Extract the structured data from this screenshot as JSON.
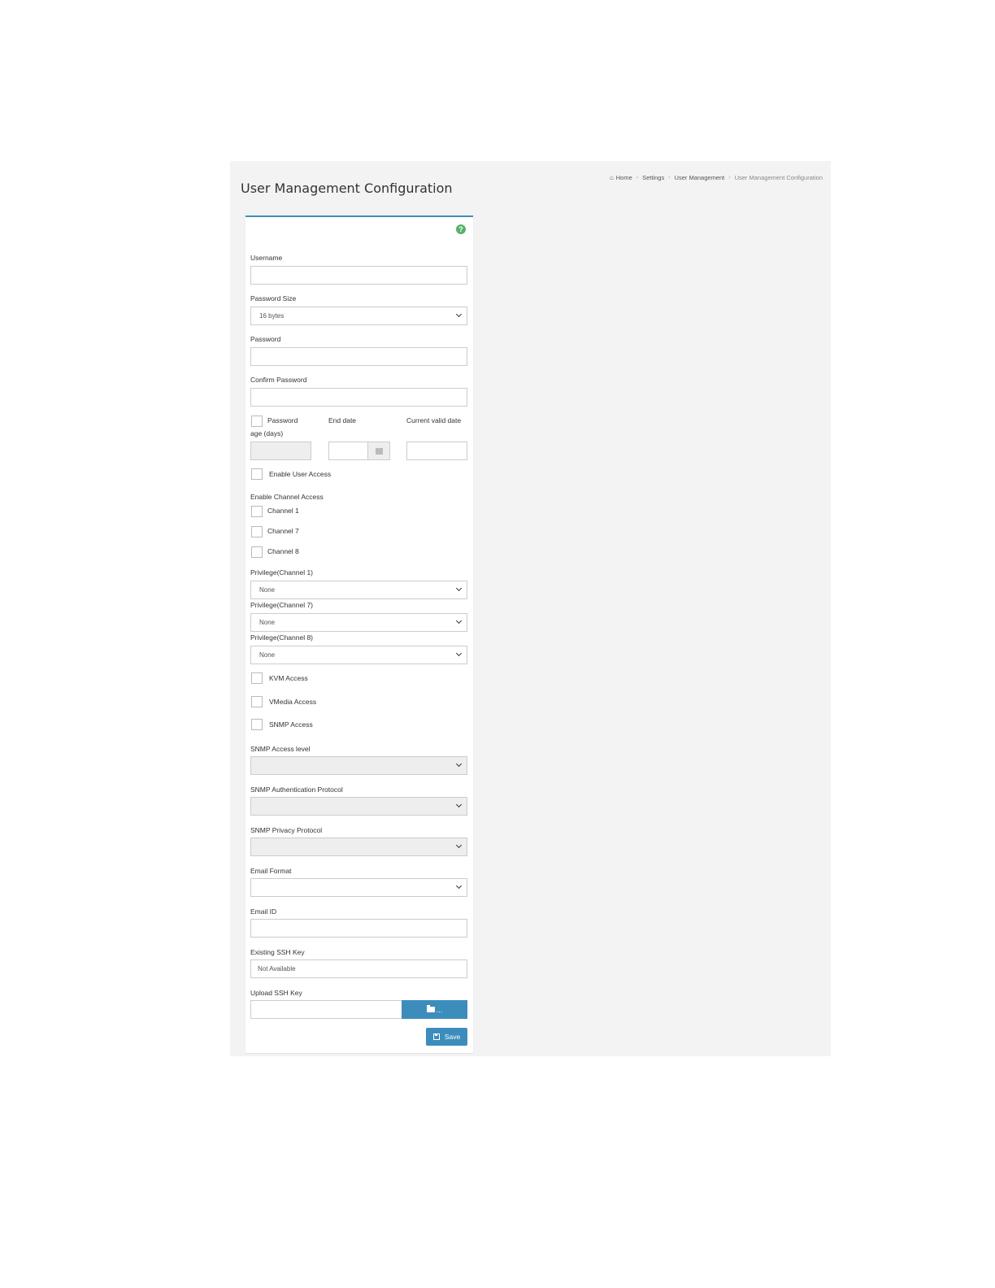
{
  "page": {
    "title": "User Management Configuration"
  },
  "breadcrumb": {
    "home": "Home",
    "settings": "Settings",
    "user_management": "User Management",
    "current": "User Management Configuration"
  },
  "form": {
    "username": {
      "label": "Username",
      "value": ""
    },
    "password_size": {
      "label": "Password Size",
      "value": "16 bytes"
    },
    "password": {
      "label": "Password",
      "value": ""
    },
    "confirm_password": {
      "label": "Confirm Password",
      "value": ""
    },
    "password_age": {
      "label_line1": "Password",
      "label_line2": "age (days)",
      "value": ""
    },
    "end_date": {
      "label": "End date",
      "value": ""
    },
    "current_valid_date": {
      "label": "Current valid date",
      "value": ""
    },
    "enable_user_access": {
      "label": "Enable User Access",
      "checked": false
    },
    "channel_access": {
      "label": "Enable Channel Access",
      "channels": [
        {
          "label": "Channel 1",
          "checked": false
        },
        {
          "label": "Channel 7",
          "checked": false
        },
        {
          "label": "Channel 8",
          "checked": false
        }
      ]
    },
    "privileges": [
      {
        "label": "Privilege(Channel 1)",
        "value": "None"
      },
      {
        "label": "Privilege(Channel 7)",
        "value": "None"
      },
      {
        "label": "Privilege(Channel 8)",
        "value": "None"
      }
    ],
    "kvm_access": {
      "label": "KVM Access",
      "checked": false
    },
    "vmedia_access": {
      "label": "VMedia Access",
      "checked": false
    },
    "snmp_access": {
      "label": "SNMP Access",
      "checked": false
    },
    "snmp_access_level": {
      "label": "SNMP Access level",
      "value": ""
    },
    "snmp_auth_protocol": {
      "label": "SNMP Authentication Protocol",
      "value": ""
    },
    "snmp_privacy_protocol": {
      "label": "SNMP Privacy Protocol",
      "value": ""
    },
    "email_format": {
      "label": "Email Format",
      "value": ""
    },
    "email_id": {
      "label": "Email ID",
      "value": ""
    },
    "existing_ssh_key": {
      "label": "Existing SSH Key",
      "value": "Not Available"
    },
    "upload_ssh_key": {
      "label": "Upload SSH Key",
      "value": "",
      "browse_label": "..."
    },
    "save_label": "Save"
  },
  "icons": {
    "home": "home-icon",
    "help": "help-icon",
    "calendar": "calendar-icon",
    "folder": "folder-open-icon",
    "save": "floppy-disk-icon"
  },
  "colors": {
    "accent": "#3c8dbc",
    "help": "#59b26a",
    "disabled_bg": "#eeeeee"
  }
}
